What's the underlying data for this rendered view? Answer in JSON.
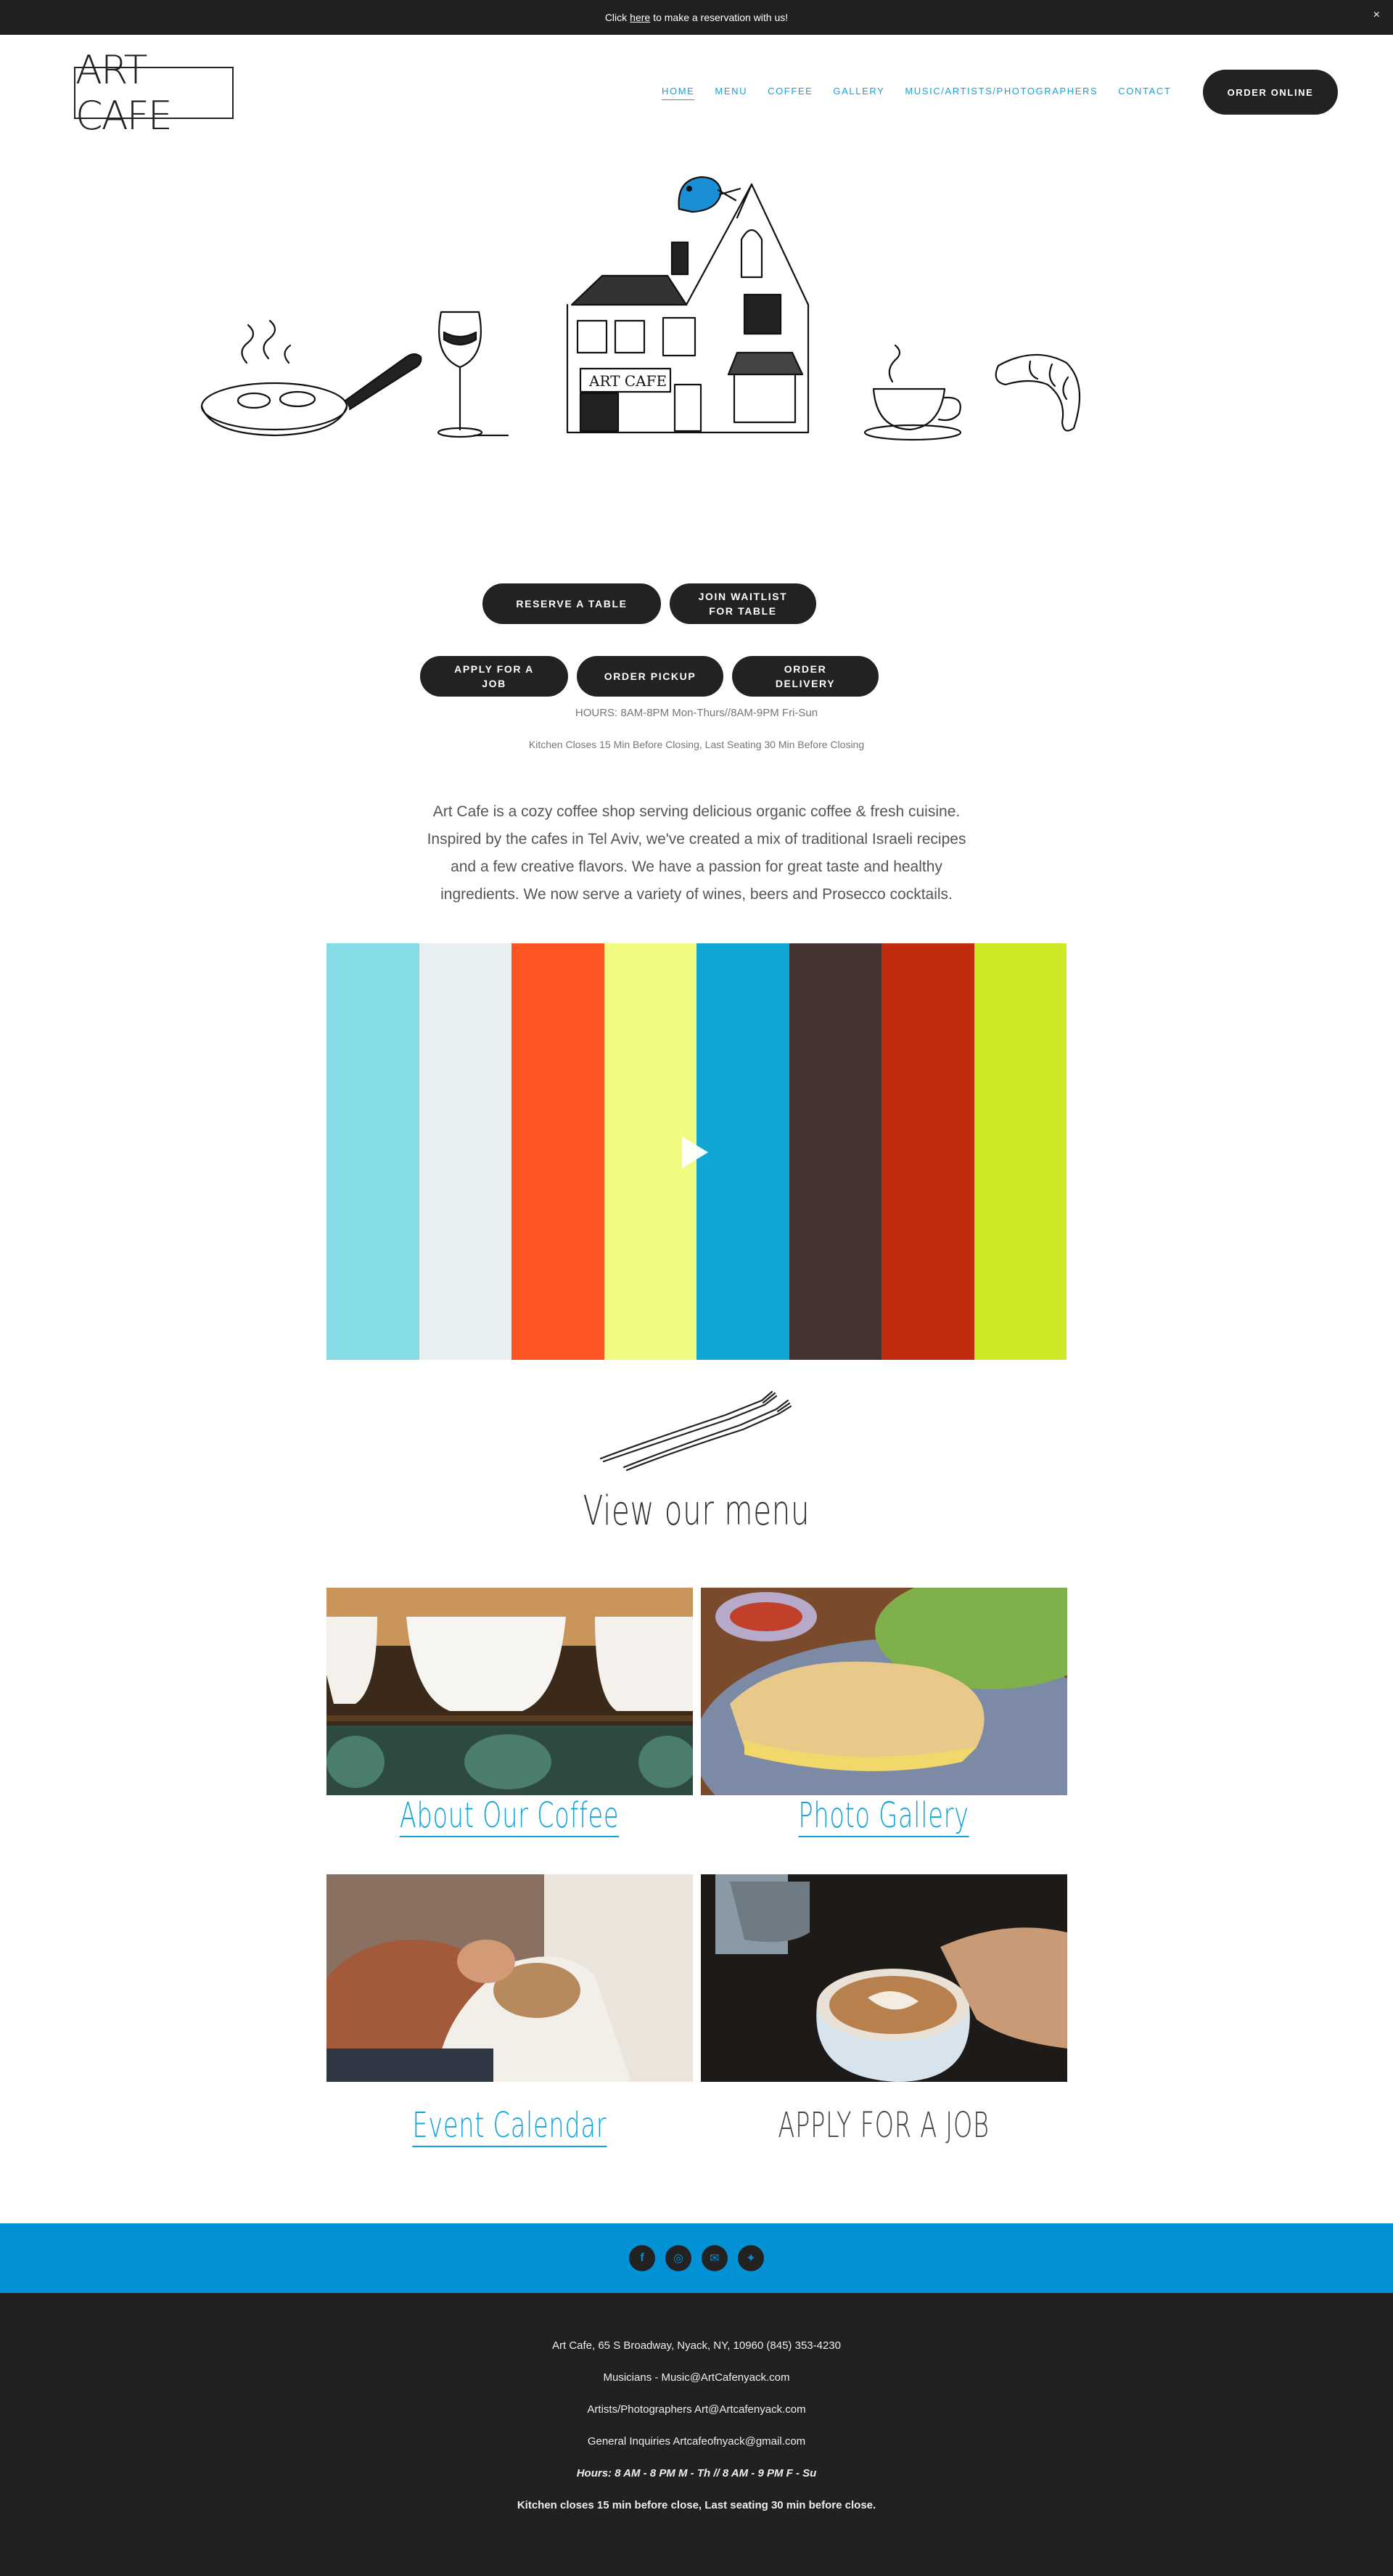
{
  "announcement": {
    "prefix": "Click",
    "link": "here",
    "suffix": "to make a reservation with us!",
    "close": "×"
  },
  "header": {
    "logo": "ART CAFE",
    "nav": [
      {
        "label": "HOME"
      },
      {
        "label": "MENU"
      },
      {
        "label": "COFFEE"
      },
      {
        "label": "GALLERY"
      },
      {
        "label": "MUSIC/ARTISTS/PHOTOGRAPHERS"
      },
      {
        "label": "CONTACT"
      }
    ],
    "order_online": "ORDER ONLINE"
  },
  "hero": {
    "sign_text": "ART CAFE"
  },
  "buttons": {
    "reserve": "RESERVE A TABLE",
    "waitlist_line1": "JOIN WAITLIST",
    "waitlist_line2": "FOR TABLE",
    "apply_line1": "APPLY FOR A",
    "apply_line2": "JOB",
    "pickup": "ORDER PICKUP",
    "delivery_line1": "ORDER",
    "delivery_line2": "DELIVERY"
  },
  "hours": {
    "line1": "HOURS: 8AM-8PM Mon-Thurs//8AM-9PM Fri-Sun",
    "line2": "Kitchen Closes 15 Min Before Closing, Last Seating 30 Min Before Closing"
  },
  "intro": "Art Cafe is a cozy coffee shop serving delicious organic coffee & fresh cuisine. Inspired by the cafes in Tel Aviv, we've created a mix of traditional Israeli recipes and a few creative flavors. We have a passion for great taste and healthy ingredients. We now serve a variety of wines, beers and Prosecco cocktails.",
  "video": {
    "bar_colors": [
      "#86dce6",
      "#e8eff2",
      "#fe5421",
      "#f1fb7f",
      "#11a6d4",
      "#453532",
      "#bf2d0c",
      "#cfe826"
    ]
  },
  "menu_section": {
    "title": "View our menu"
  },
  "tiles": [
    {
      "label": "About Our Coffee"
    },
    {
      "label": "Photo Gallery"
    },
    {
      "label": "Event Calendar"
    },
    {
      "label": "APPLY FOR A JOB"
    }
  ],
  "social": [
    {
      "icon": "facebook-icon",
      "glyph": "f"
    },
    {
      "icon": "instagram-icon",
      "glyph": "◎"
    },
    {
      "icon": "email-icon",
      "glyph": "✉"
    },
    {
      "icon": "twitter-icon",
      "glyph": "✦"
    }
  ],
  "footer": {
    "address": "Art Cafe, 65 S Broadway, Nyack, NY, 10960   (845) 353-4230",
    "musicians": "Musicians - Music@ArtCafenyack.com",
    "artists": "Artists/Photographers Art@Artcafenyack.com",
    "general": "General Inquiries Artcafeofnyack@gmail.com",
    "hours": "Hours: 8 AM - 8 PM M - Th // 8 AM - 9 PM F - Su",
    "kitchen": "Kitchen closes 15 min before close, Last seating 30 min before close."
  }
}
